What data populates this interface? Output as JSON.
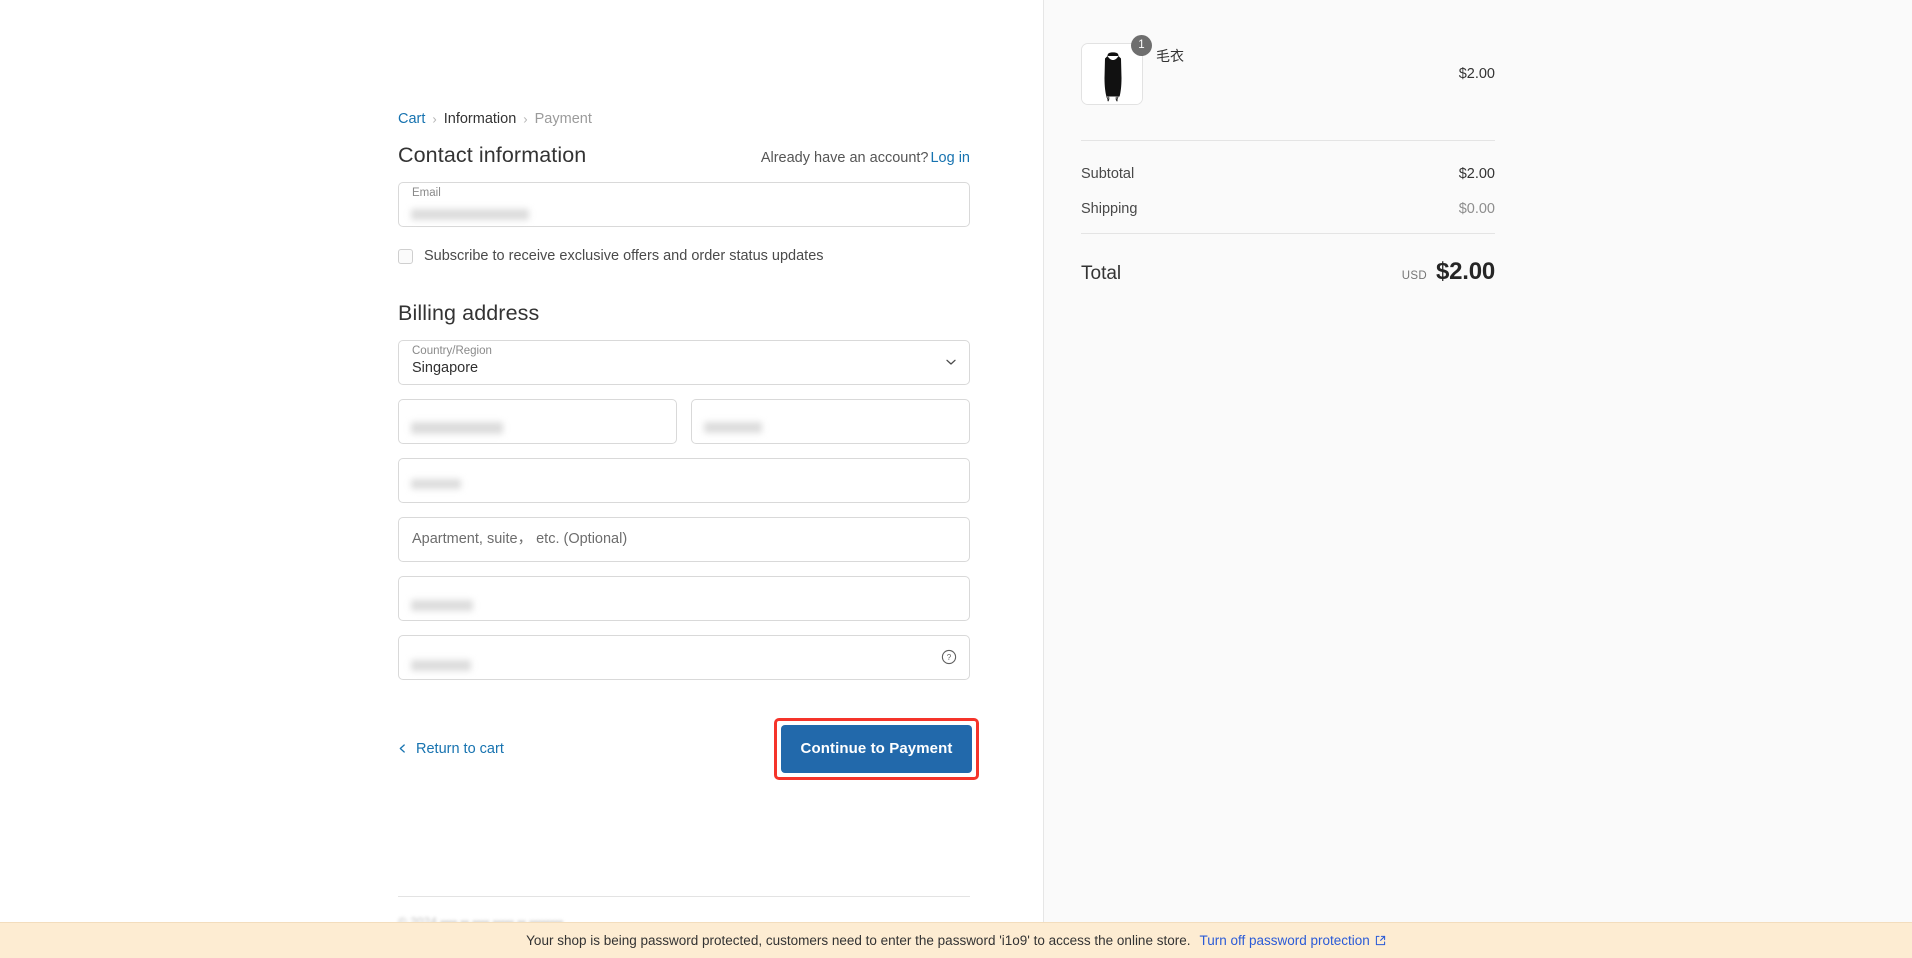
{
  "breadcrumb": {
    "cart": "Cart",
    "information": "Information",
    "payment": "Payment",
    "separator": "›"
  },
  "contact": {
    "title": "Contact information",
    "account_prompt": "Already have an account?",
    "login_label": "Log in",
    "email_label": "Email",
    "email_value_redacted": true,
    "subscribe_label": "Subscribe to receive exclusive offers and order status updates",
    "subscribe_checked": false
  },
  "billing": {
    "title": "Billing address",
    "country_label": "Country/Region",
    "country_value": "Singapore",
    "first_name_redacted": true,
    "last_name_redacted": true,
    "address_redacted": true,
    "apartment_placeholder": "Apartment, suite， etc. (Optional)",
    "apartment_value": "",
    "city_redacted": true,
    "postal_redacted": true
  },
  "actions": {
    "return_label": "Return to cart",
    "continue_label": "Continue to Payment",
    "highlight_color": "#f5342a",
    "button_color": "#2269ab"
  },
  "summary": {
    "items": [
      {
        "name": "毛衣",
        "quantity": "1",
        "price": "$2.00"
      }
    ],
    "subtotal_label": "Subtotal",
    "subtotal_value": "$2.00",
    "shipping_label": "Shipping",
    "shipping_value": "$0.00",
    "total_label": "Total",
    "currency_code": "USD",
    "total_value": "$2.00"
  },
  "banner": {
    "message": "Your shop is being password protected, customers need to enter the password 'i1o9' to access the online store.",
    "link_label": "Turn off password protection"
  },
  "colors": {
    "link_blue": "#1773b0",
    "banner_bg": "#fdecd2",
    "banner_link": "#2b5bd7",
    "sidebar_bg": "#fafafa"
  }
}
